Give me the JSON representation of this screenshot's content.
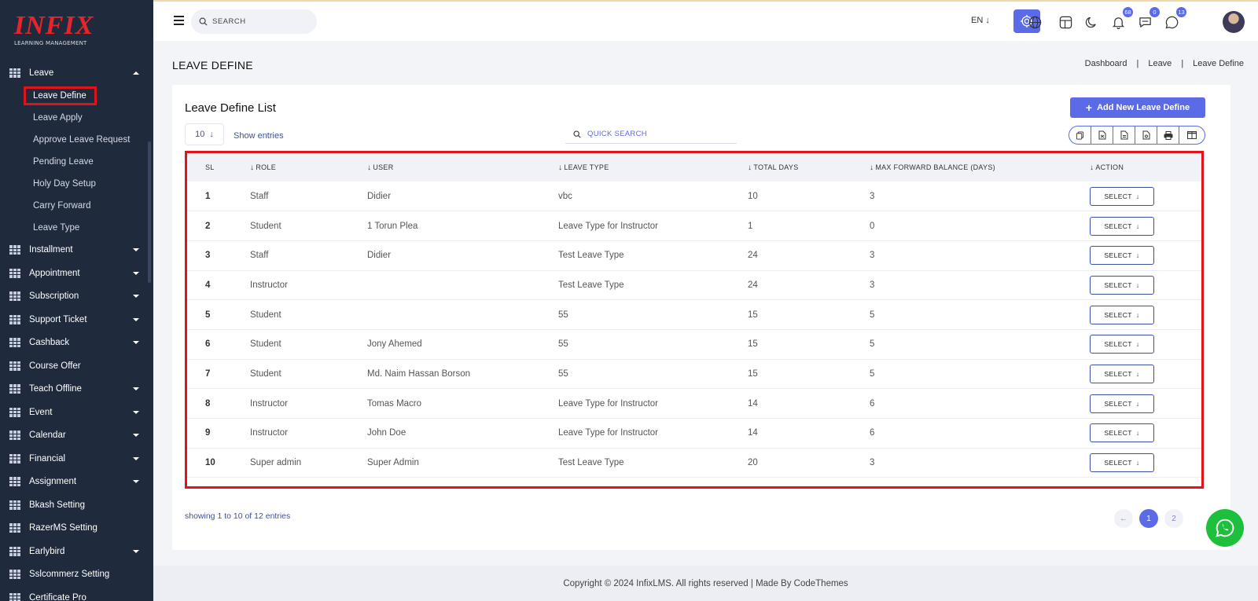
{
  "brand": {
    "logo": "INFIX",
    "subtitle": "LEARNING MANAGEMENT"
  },
  "sidebar": {
    "open_group": "Leave",
    "sub_items": [
      "Leave Define",
      "Leave Apply",
      "Approve Leave Request",
      "Pending Leave",
      "Holy Day Setup",
      "Carry Forward",
      "Leave Type"
    ],
    "groups": [
      {
        "label": "Installment",
        "caret": true
      },
      {
        "label": "Appointment",
        "caret": true
      },
      {
        "label": "Subscription",
        "caret": true
      },
      {
        "label": "Support Ticket",
        "caret": true
      },
      {
        "label": "Cashback",
        "caret": true
      },
      {
        "label": "Course Offer",
        "caret": false
      },
      {
        "label": "Teach Offline",
        "caret": true
      },
      {
        "label": "Event",
        "caret": true
      },
      {
        "label": "Calendar",
        "caret": true
      },
      {
        "label": "Financial",
        "caret": true
      },
      {
        "label": "Assignment",
        "caret": true
      },
      {
        "label": "Bkash Setting",
        "caret": false
      },
      {
        "label": "RazerMS Setting",
        "caret": false
      },
      {
        "label": "Earlybird",
        "caret": true
      },
      {
        "label": "Sslcommerz Setting",
        "caret": false
      },
      {
        "label": "Certificate Pro",
        "caret": false
      }
    ]
  },
  "header": {
    "search_placeholder": "SEARCH",
    "language": "EN",
    "notifications_count": "68",
    "messages_count": "0",
    "chat_count": "13"
  },
  "page": {
    "title": "LEAVE DEFINE",
    "breadcrumb": [
      "Dashboard",
      "Leave",
      "Leave Define"
    ]
  },
  "card": {
    "title": "Leave Define List",
    "add_button": "Add New Leave Define",
    "page_size": "10",
    "show_entries": "Show entries",
    "quick_search_placeholder": "QUICK SEARCH",
    "showing": "showing 1 to 10 of 12 entries",
    "pages": [
      "1",
      "2"
    ],
    "select_label": "SELECT"
  },
  "table": {
    "headers": [
      "SL",
      "ROLE",
      "USER",
      "LEAVE TYPE",
      "TOTAL DAYS",
      "MAX FORWARD BALANCE (DAYS)",
      "ACTION"
    ],
    "rows": [
      [
        "1",
        "Staff",
        "Didier",
        "vbc",
        "10",
        "3"
      ],
      [
        "2",
        "Student",
        "1 Torun Plea",
        "Leave Type for Instructor",
        "1",
        "0"
      ],
      [
        "3",
        "Staff",
        "Didier",
        "Test Leave Type",
        "24",
        "3"
      ],
      [
        "4",
        "Instructor",
        "",
        "Test Leave Type",
        "24",
        "3"
      ],
      [
        "5",
        "Student",
        "",
        "55",
        "15",
        "5"
      ],
      [
        "6",
        "Student",
        "Jony Ahemed",
        "55",
        "15",
        "5"
      ],
      [
        "7",
        "Student",
        "Md. Naim Hassan Borson",
        "55",
        "15",
        "5"
      ],
      [
        "8",
        "Instructor",
        "Tomas Macro",
        "Leave Type for Instructor",
        "14",
        "6"
      ],
      [
        "9",
        "Instructor",
        "John Doe",
        "Leave Type for Instructor",
        "14",
        "6"
      ],
      [
        "10",
        "Super admin",
        "Super Admin",
        "Test Leave Type",
        "20",
        "3"
      ]
    ]
  },
  "footer": {
    "text": "Copyright © 2024 InfixLMS. All rights reserved | Made By CodeThemes"
  },
  "colors": {
    "primary": "#5b6ae6",
    "sidebar": "#202a3d",
    "highlight": "#e0131a",
    "whatsapp": "#1fbf3e"
  }
}
